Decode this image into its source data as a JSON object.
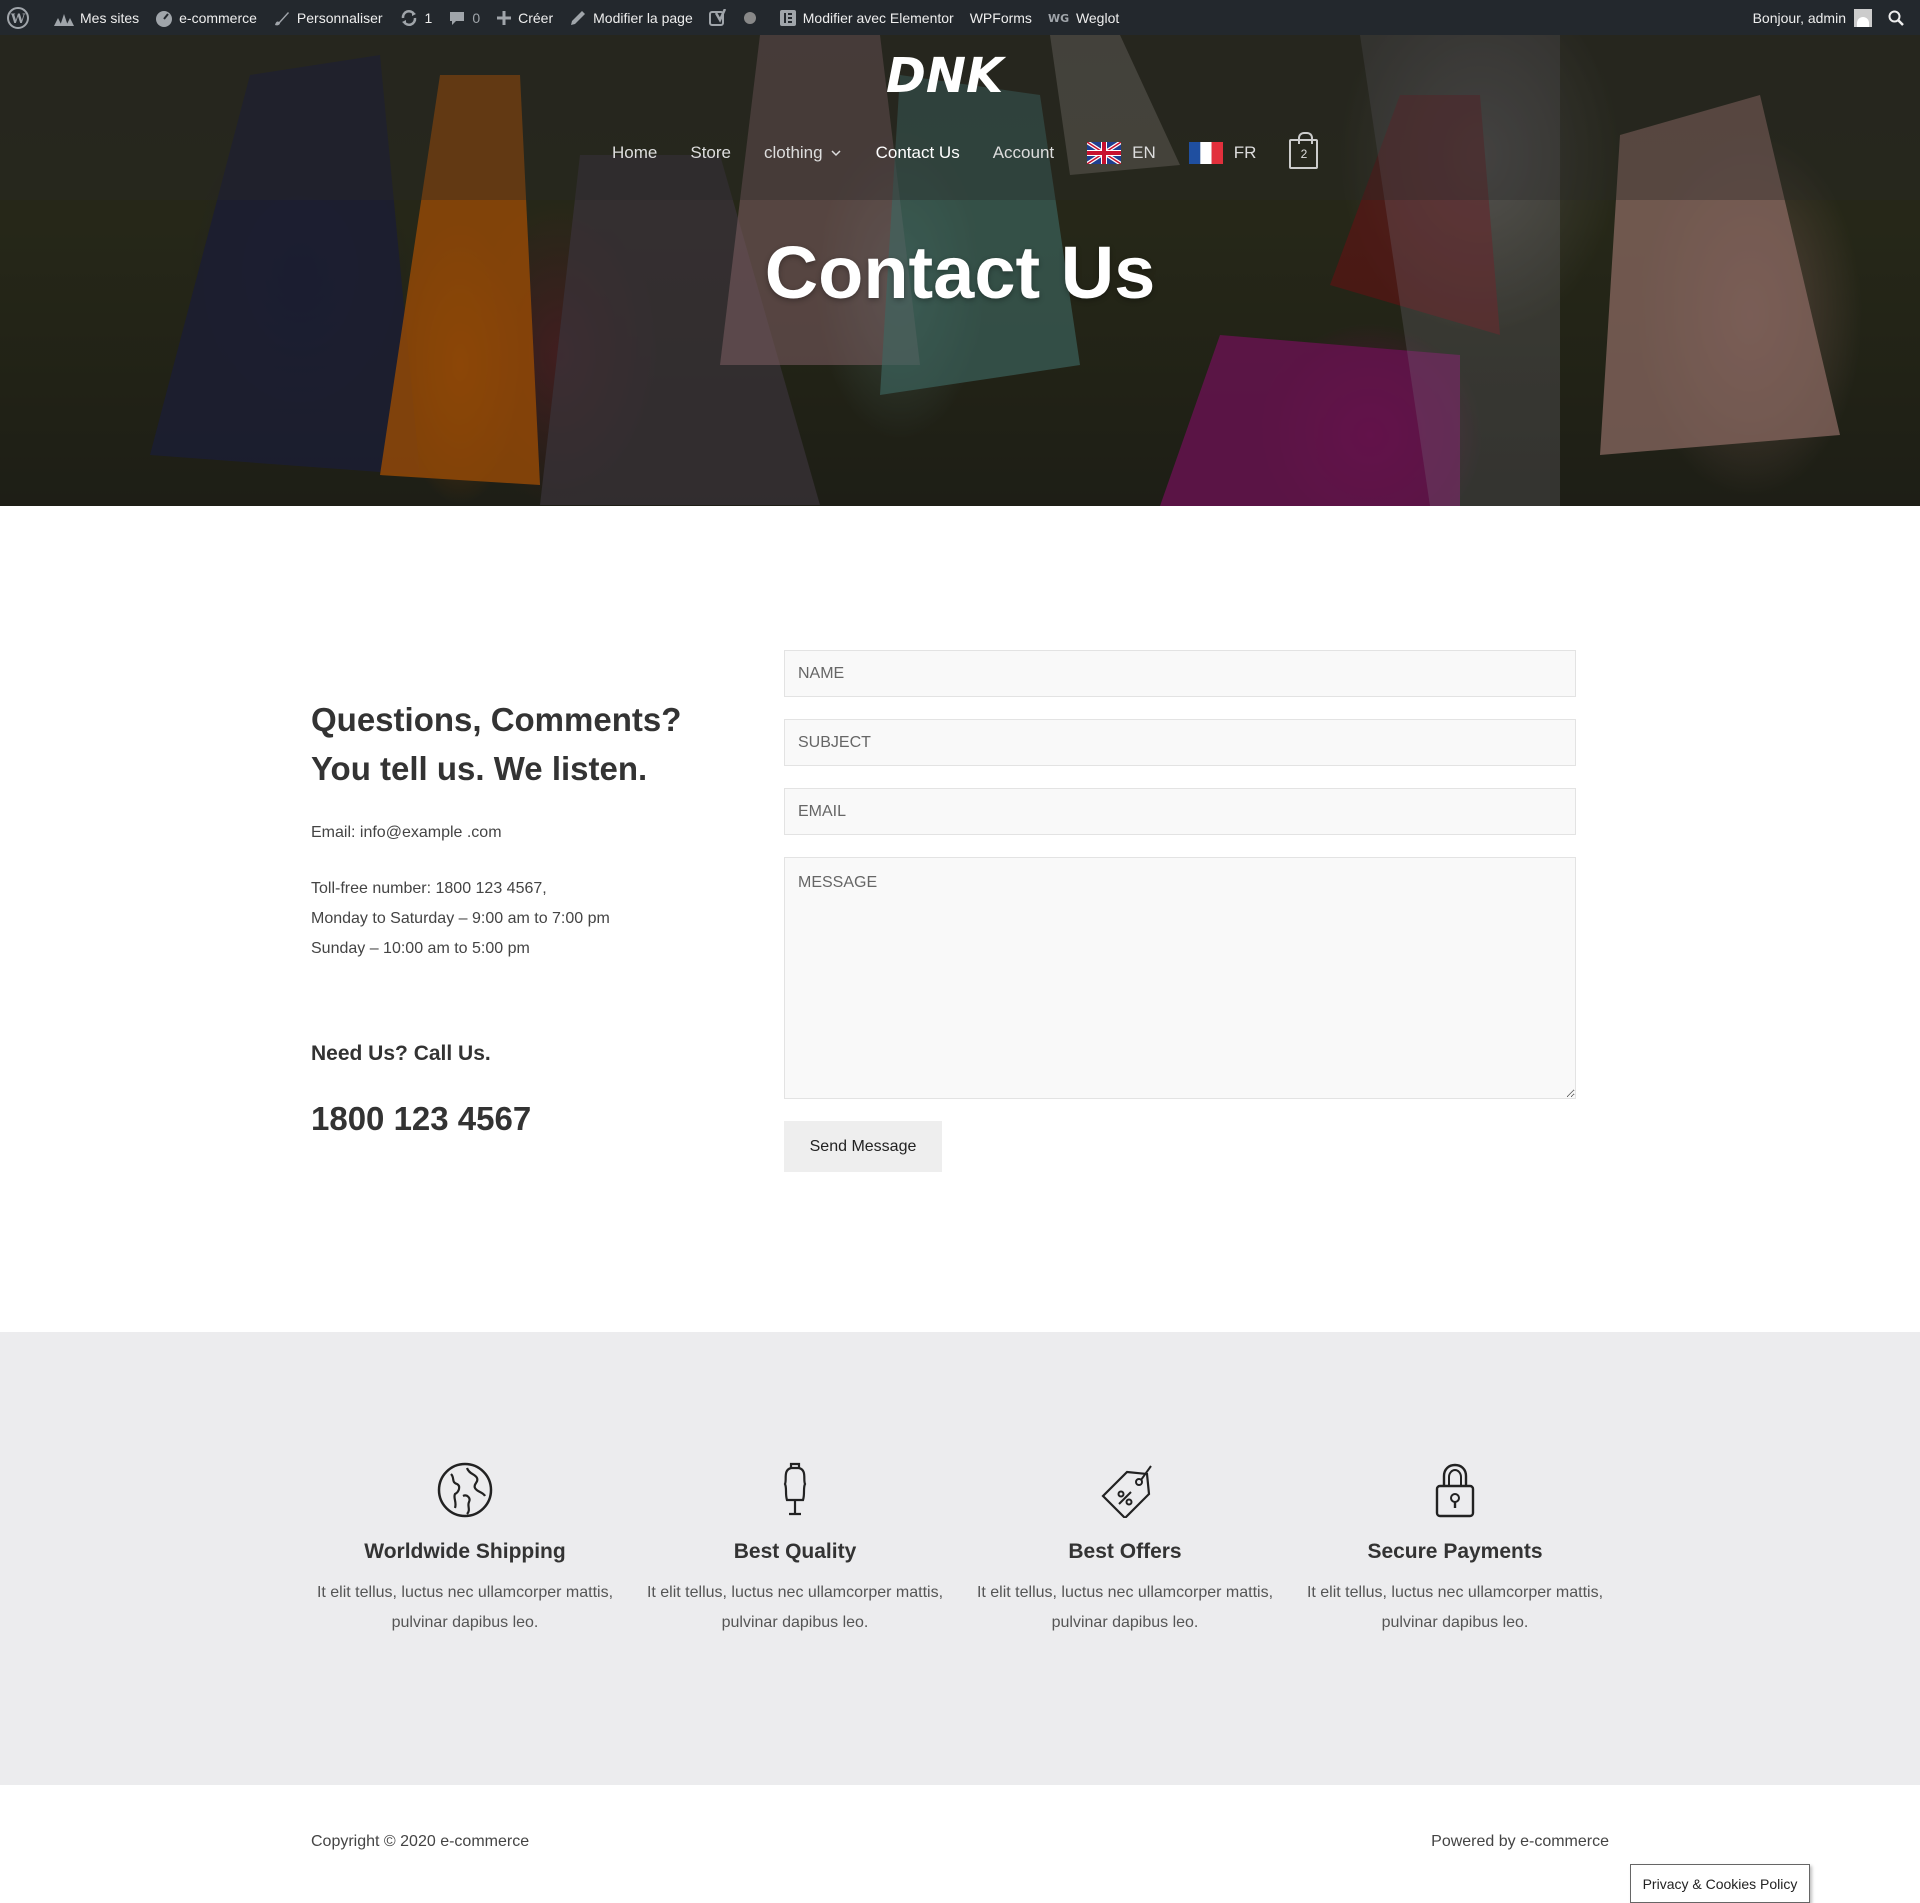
{
  "adminbar": {
    "items": [
      {
        "label": "Mes sites"
      },
      {
        "label": "e-commerce"
      },
      {
        "label": "Personnaliser"
      },
      {
        "label": "1"
      },
      {
        "label": "0"
      },
      {
        "label": "Créer"
      },
      {
        "label": "Modifier la page"
      },
      {
        "label": "Modifier avec Elementor"
      },
      {
        "label": "WPForms"
      },
      {
        "label": "Weglot"
      }
    ],
    "greeting": "Bonjour, admin"
  },
  "header": {
    "logo_text": "DNK",
    "nav": [
      {
        "label": "Home"
      },
      {
        "label": "Store"
      },
      {
        "label": "clothing"
      },
      {
        "label": "Contact Us"
      },
      {
        "label": "Account"
      },
      {
        "label": "EN"
      },
      {
        "label": "FR"
      }
    ],
    "cart_count": "2"
  },
  "hero": {
    "title": "Contact Us"
  },
  "contact": {
    "heading": "Questions, Comments? You tell us. We listen.",
    "email": "Email: info@example .com",
    "phone_lines": [
      "Toll-free number: 1800 123 4567,",
      "Monday to Saturday – 9:00 am to 7:00 pm",
      "Sunday – 10:00 am to 5:00 pm"
    ],
    "call_title": "Need Us? Call Us.",
    "call_number": "1800 123 4567"
  },
  "form": {
    "name_placeholder": "NAME",
    "subject_placeholder": "SUBJECT",
    "email_placeholder": "EMAIL",
    "message_placeholder": "MESSAGE",
    "send_label": "Send Message"
  },
  "features": [
    {
      "icon": "globe-icon",
      "title": "Worldwide Shipping",
      "text": "It elit tellus, luctus nec ullamcorper mattis, pulvinar dapibus leo."
    },
    {
      "icon": "mannequin-icon",
      "title": "Best Quality",
      "text": "It elit tellus, luctus nec ullamcorper mattis, pulvinar dapibus leo."
    },
    {
      "icon": "price-tag-icon",
      "title": "Best Offers",
      "text": "It elit tellus, luctus nec ullamcorper mattis, pulvinar dapibus leo."
    },
    {
      "icon": "padlock-icon",
      "title": "Secure Payments",
      "text": "It elit tellus, luctus nec ullamcorper mattis, pulvinar dapibus leo."
    }
  ],
  "footer": {
    "copyright": "Copyright © 2020 e-commerce",
    "powered": "Powered by e-commerce",
    "cookie": "Privacy & Cookies Policy"
  },
  "colors": {
    "adminbar_bg": "#23282d",
    "features_bg": "#ececee",
    "text": "#333333"
  }
}
